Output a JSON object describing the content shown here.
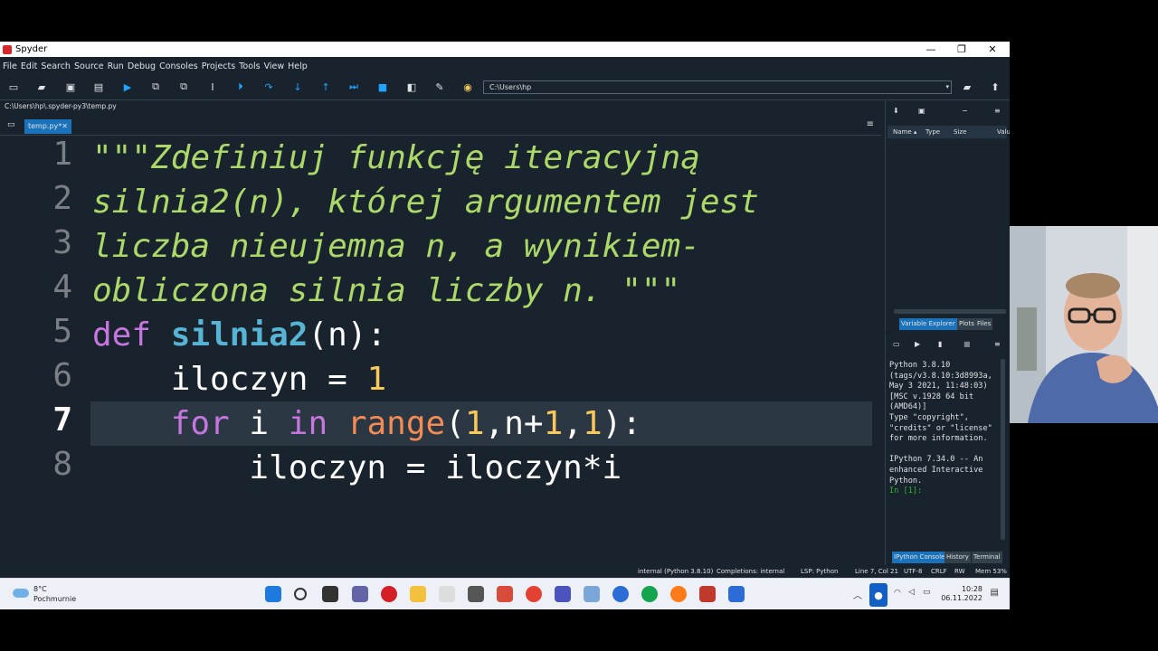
{
  "window": {
    "title": "Spyder",
    "minimize": "—",
    "maximize": "❐",
    "close": "✕"
  },
  "menu": [
    "File",
    "Edit",
    "Search",
    "Source",
    "Run",
    "Debug",
    "Consoles",
    "Projects",
    "Tools",
    "View",
    "Help"
  ],
  "toolbar": {
    "path": "C:\\Users\\hp"
  },
  "editor": {
    "file_path": "C:\\Users\\hp\\.spyder-py3\\temp.py",
    "tab_label": "temp.py*",
    "tab_close": "✕",
    "current_line": 7,
    "line_numbers": [
      "1",
      "2",
      "3",
      "4",
      "5",
      "6",
      "7",
      "8"
    ],
    "lines": {
      "l1": "\"\"\"Zdefiniuj funkcję iteracyjną",
      "l2": "silnia2(n), której argumentem jest",
      "l3": "liczba nieujemna n, a wynikiem-",
      "l4": "obliczona silnia liczby n. \"\"\"",
      "l5_kw": "def",
      "l5_fn": "silnia2",
      "l5_rest": "(n):",
      "l6_a": "    iloczyn = ",
      "l6_num": "1",
      "l7_for": "for",
      "l7_i": " i ",
      "l7_in": "in",
      "l7_range": "range",
      "l7_p1": "(",
      "l7_n1": "1",
      "l7_mid": ",n+",
      "l7_n2": "1",
      "l7_comma": ",",
      "l7_n3": "1",
      "l7_end": "):",
      "l8": "        iloczyn = iloczyn*i"
    }
  },
  "variable_explorer": {
    "columns": [
      "Name ▴",
      "Type",
      "Size",
      "Valu"
    ],
    "tabs": [
      "Variable Explorer",
      "Plots",
      "Files"
    ]
  },
  "console": {
    "banner": "Python 3.8.10 (tags/v3.8.10:3d8993a, May 3 2021, 11:48:03) [MSC v.1928 64 bit (AMD64)]\nType \"copyright\", \"credits\" or \"license\" for more information.\n\nIPython 7.34.0 -- An enhanced Interactive Python.\n",
    "prompt": "In [1]:",
    "tabs": [
      "IPython Console",
      "History",
      "Terminal"
    ]
  },
  "statusbar": {
    "interpreter": "internal (Python 3.8.10)",
    "completions": "Completions: internal",
    "lsp": "LSP: Python",
    "position": "Line 7, Col 21",
    "encoding": "UTF-8",
    "eol": "CRLF",
    "perm": "RW",
    "mem": "Mem 53%"
  },
  "taskbar": {
    "temp": "8°C",
    "weather": "Pochmurnie",
    "time": "10:28",
    "date": "06.11.2022"
  },
  "colors": {
    "accent": "#1a72bb",
    "docstring": "#abd868",
    "keyword": "#c776e0",
    "function": "#57b4d4",
    "number": "#f7c95b",
    "builtin": "#f28b54"
  }
}
